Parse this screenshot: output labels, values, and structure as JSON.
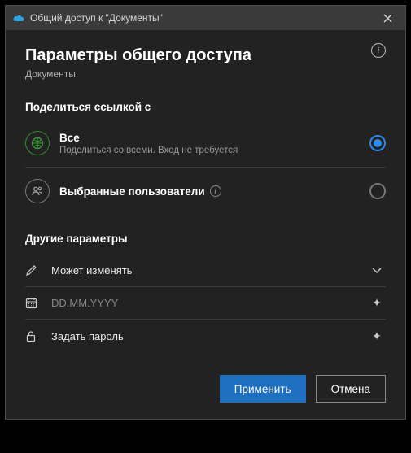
{
  "titlebar": {
    "title": "Общий доступ к \"Документы\""
  },
  "header": {
    "title": "Параметры общего доступа",
    "subtitle": "Документы"
  },
  "share_section": {
    "label": "Поделиться ссылкой с",
    "options": [
      {
        "title": "Все",
        "desc": "Поделиться со всеми. Вход не требуется",
        "selected": true
      },
      {
        "title": "Выбранные пользователи",
        "selected": false
      }
    ]
  },
  "other_section": {
    "label": "Другие параметры",
    "permission": {
      "label": "Может изменять"
    },
    "expiry": {
      "placeholder": "DD.MM.YYYY"
    },
    "password": {
      "label": "Задать пароль"
    }
  },
  "footer": {
    "apply": "Применить",
    "cancel": "Отмена"
  }
}
